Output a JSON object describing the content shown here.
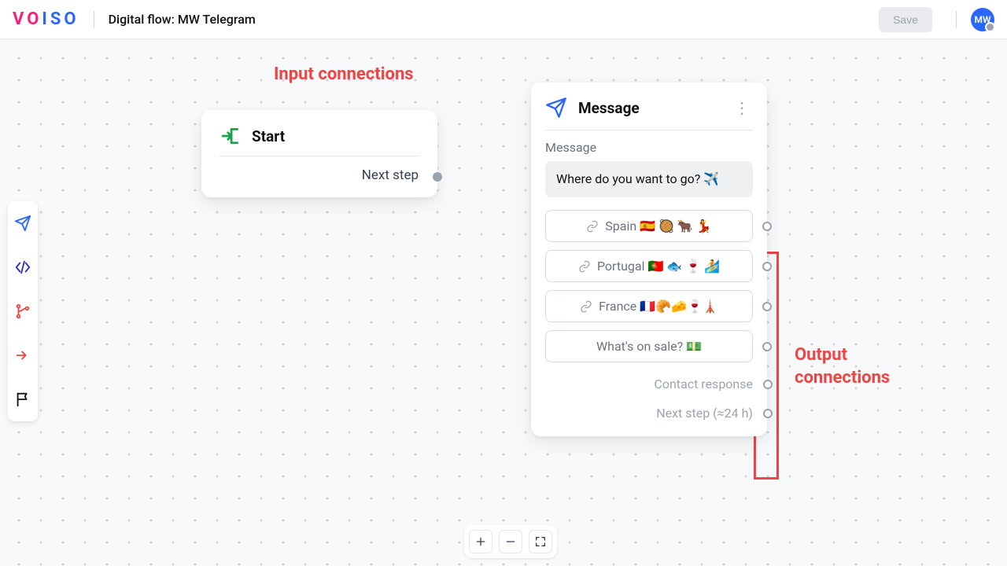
{
  "header": {
    "logo_text": "VOISO",
    "title": "Digital flow: MW Telegram",
    "save_label": "Save",
    "avatar_initials": "MW"
  },
  "annotations": {
    "input_label": "Input connections",
    "output_label": "Output\nconnections"
  },
  "toolbar": {
    "items": [
      {
        "name": "message-tool",
        "color": "#2b66ff"
      },
      {
        "name": "code-tool",
        "color": "#2b66ff"
      },
      {
        "name": "branch-tool",
        "color": "#ef4444"
      },
      {
        "name": "redirect-tool",
        "color": "#ef4444"
      },
      {
        "name": "flag-tool",
        "color": "#111"
      }
    ]
  },
  "nodes": {
    "start": {
      "title": "Start",
      "next_label": "Next step"
    },
    "message": {
      "title": "Message",
      "section_label": "Message",
      "body": "Where do you want to go? ✈️",
      "options": [
        {
          "label": "Spain 🇪🇸 🥘 🐂 💃"
        },
        {
          "label": "Portugal 🇵🇹 🐟 🍷 🏄"
        },
        {
          "label": "France 🇫🇷🥐🧀🍷🗼"
        },
        {
          "label": "What's on sale? 💵"
        }
      ],
      "trailing": [
        {
          "label": "Contact response"
        },
        {
          "label": "Next step (≈24 h)"
        }
      ]
    }
  },
  "zoom": {
    "in": "+",
    "out": "−"
  }
}
